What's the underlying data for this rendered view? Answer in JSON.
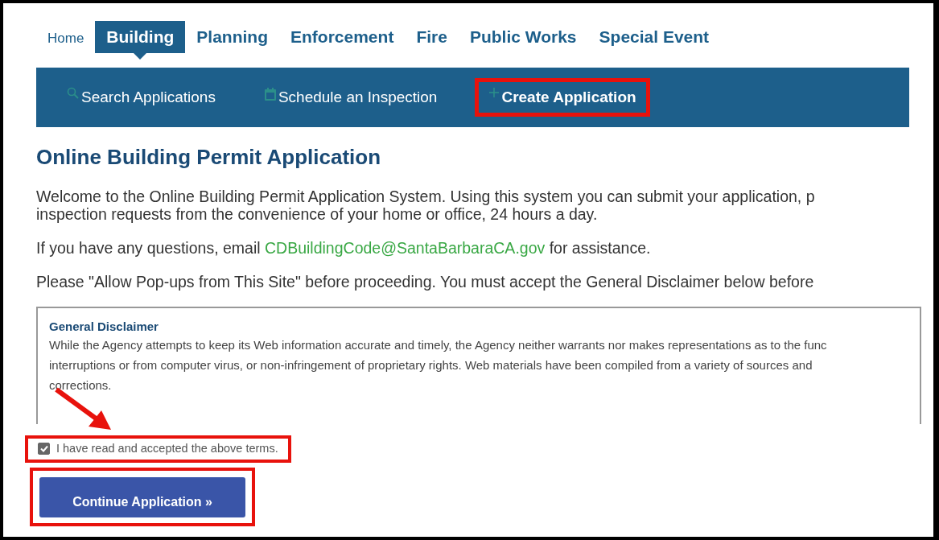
{
  "tabs": [
    {
      "label": "Home",
      "selected": false
    },
    {
      "label": "Building",
      "selected": true
    },
    {
      "label": "Planning",
      "selected": false
    },
    {
      "label": "Enforcement",
      "selected": false
    },
    {
      "label": "Fire",
      "selected": false
    },
    {
      "label": "Public Works",
      "selected": false
    },
    {
      "label": "Special Event",
      "selected": false
    }
  ],
  "subnav": [
    {
      "kind": "search",
      "label": "Search Applications",
      "selected": false,
      "highlighted": false
    },
    {
      "kind": "calendar",
      "label": "Schedule an Inspection",
      "selected": false,
      "highlighted": false
    },
    {
      "kind": "plus",
      "label": "Create Application",
      "selected": true,
      "highlighted": true
    }
  ],
  "page_title": "Online Building Permit Application",
  "intro_lines": [
    "Welcome to the Online Building Permit Application System. Using this system you can submit your application, p",
    "inspection requests from the convenience of your home or office, 24 hours a day."
  ],
  "contact": {
    "before": "If you have any questions, email ",
    "email": "CDBuildingCode@SantaBarbaraCA.gov",
    "after": " for assistance."
  },
  "popup_note": "Please \"Allow Pop-ups from This Site\" before proceeding. You must accept the General Disclaimer below before",
  "disclaimer": {
    "title": "General Disclaimer",
    "lines": [
      "While the Agency attempts to keep its Web information accurate and timely, the Agency neither warrants nor makes representations as to the func",
      "interruptions or from computer virus, or non-infringement of proprietary rights. Web materials have been compiled from a variety of sources and",
      "corrections."
    ]
  },
  "accept": {
    "label": "I have read and accepted the above terms.",
    "checked": true,
    "highlighted": true
  },
  "continue_button": {
    "label": "Continue Application »",
    "highlighted": true
  }
}
